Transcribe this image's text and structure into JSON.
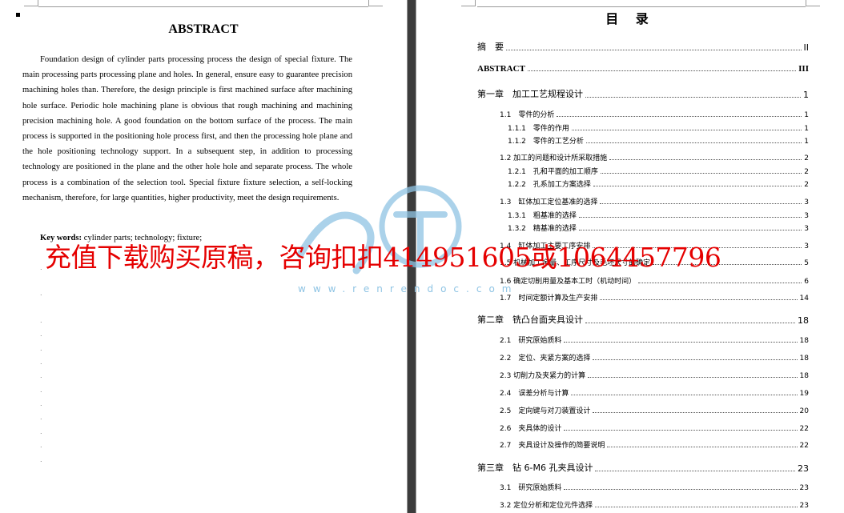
{
  "left_page": {
    "title": "ABSTRACT",
    "body": "Foundation design of cylinder parts processing process the design of special fixture. The main processing parts processing plane and holes. In general, ensure easy to guarantee precision machining holes than. Therefore, the design principle is first machined surface after machining hole surface. Periodic hole machining plane is obvious that rough machining and machining precision machining hole. A good foundation on the bottom surface of the process. The main process is supported in the positioning hole process first, and then the processing hole plane and the hole positioning technology support. In a subsequent step, in addition to processing technology are positioned in the plane and the other hole hole and separate process. The whole process is a combination of the selection tool. Special fixture fixture selection, a self-locking mechanism, therefore, for large quantities, higher productivity, meet the design requirements.",
    "keywords_label": "Key words:",
    "keywords": "cylinder parts; technology; fixture;"
  },
  "right_page": {
    "title": "目 录",
    "entries": [
      {
        "text": "摘　要",
        "page": "II"
      },
      {
        "text": "ABSTRACT",
        "page": "III"
      },
      {
        "text": "第一章　加工工艺规程设计",
        "page": "1"
      },
      {
        "text": "1.1　零件的分析",
        "page": "1"
      },
      {
        "text": "1.1.1　零件的作用",
        "page": "1"
      },
      {
        "text": "1.1.2　零件的工艺分析",
        "page": "1"
      },
      {
        "text": "1.2 加工的问题和设计所采取措施",
        "page": "2"
      },
      {
        "text": "1.2.1　孔和平面的加工顺序",
        "page": "2"
      },
      {
        "text": "1.2.2　孔系加工方案选择",
        "page": "2"
      },
      {
        "text": "1.3　缸体加工定位基准的选择",
        "page": "3"
      },
      {
        "text": "1.3.1　粗基准的选择",
        "page": "3"
      },
      {
        "text": "1.3.2　精基准的选择",
        "page": "3"
      },
      {
        "text": "1.4　缸体加工主要工序安排",
        "page": "3"
      },
      {
        "text": "1.5 机械加工余量、工序尺寸及毛坯尺寸的确定",
        "page": "5"
      },
      {
        "text": "1.6 确定切削用量及基本工时（机动时间）",
        "page": "6"
      },
      {
        "text": "1.7　时间定额计算及生产安排",
        "page": "14"
      },
      {
        "text": "第二章　铣凸台面夹具设计",
        "page": "18"
      },
      {
        "text": "2.1　研究原始质料",
        "page": "18"
      },
      {
        "text": "2.2　定位、夹紧方案的选择",
        "page": "18"
      },
      {
        "text": "2.3 切削力及夹紧力的计算",
        "page": "18"
      },
      {
        "text": "2.4　误差分析与计算",
        "page": "19"
      },
      {
        "text": "2.5　定向键与对刀装置设计",
        "page": "20"
      },
      {
        "text": "2.6　夹具体的设计",
        "page": "22"
      },
      {
        "text": "2.7　夹具设计及操作的简要说明",
        "page": "22"
      },
      {
        "text": "第三章　钻 6-M6 孔夹具设计",
        "page": "23"
      },
      {
        "text": "3.1　研究原始质料",
        "page": "23"
      },
      {
        "text": "3.2 定位分析和定位元件选择",
        "page": "23"
      }
    ]
  },
  "watermark": {
    "text": "充值下载购买原稿，咨询扣扣414951605或1064457796",
    "site": "www.renrendoc.com",
    "accent_color": "#e50000",
    "logo_color": "#8fc4e4"
  }
}
